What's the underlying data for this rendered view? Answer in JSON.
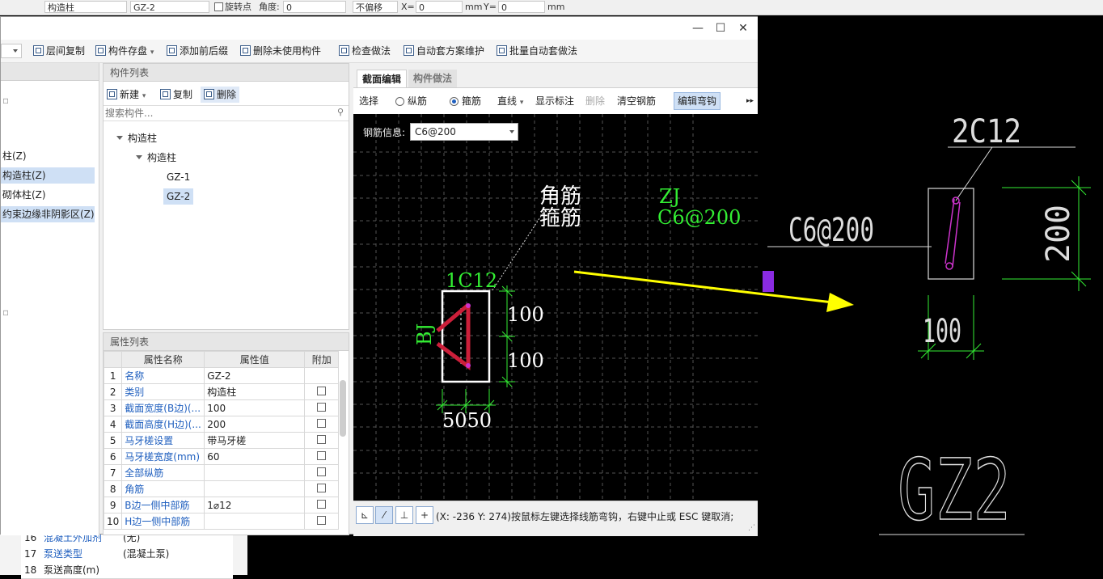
{
  "top_strip": {
    "type_value": "构造柱",
    "name_value": "GZ-2",
    "rotate_label": "旋转点",
    "angle_label": "角度:",
    "angle_value": "0",
    "offset_value": "不偏移",
    "x_label": "X=",
    "x_value": "0",
    "mm1": "mm",
    "y_label": "Y=",
    "y_value": "0",
    "mm2": "mm"
  },
  "toolbar": {
    "floor_copy": "层间复制",
    "save_component": "构件存盘",
    "add_prefix": "添加前后缀",
    "delete_unused": "删除未使用构件",
    "check_method": "检查做法",
    "auto_scheme": "自动套方案维护",
    "batch_auto": "批量自动套做法"
  },
  "left_panel": {
    "items": [
      "柱(Z)",
      "构造柱(Z)",
      "砌体柱(Z)",
      "约束边缘非阴影区(Z)"
    ]
  },
  "component_list": {
    "header": "构件列表",
    "new_label": "新建",
    "copy_label": "复制",
    "delete_label": "删除",
    "search_placeholder": "搜索构件...",
    "tree": {
      "root": "构造柱",
      "group": "构造柱",
      "items": [
        "GZ-1",
        "GZ-2"
      ]
    }
  },
  "property_list": {
    "header": "属性列表",
    "col_name": "属性名称",
    "col_value": "属性值",
    "col_extra": "附加",
    "rows": [
      {
        "no": "1",
        "name": "名称",
        "value": "GZ-2",
        "check": false
      },
      {
        "no": "2",
        "name": "类别",
        "value": "构造柱",
        "check": true
      },
      {
        "no": "3",
        "name": "截面宽度(B边)(...",
        "value": "100",
        "check": true
      },
      {
        "no": "4",
        "name": "截面高度(H边)(...",
        "value": "200",
        "check": true
      },
      {
        "no": "5",
        "name": "马牙槎设置",
        "value": "带马牙槎",
        "check": true
      },
      {
        "no": "6",
        "name": "马牙槎宽度(mm)",
        "value": "60",
        "check": true
      },
      {
        "no": "7",
        "name": "全部纵筋",
        "value": "",
        "check": true
      },
      {
        "no": "8",
        "name": "角筋",
        "value": "",
        "check": true
      },
      {
        "no": "9",
        "name": "B边一侧中部筋",
        "value": "1⌀12",
        "check": true
      },
      {
        "no": "10",
        "name": "H边一侧中部筋",
        "value": "",
        "check": true
      }
    ]
  },
  "background_rows": [
    {
      "no": "16",
      "name": "混凝土外加剂",
      "value": "(无)"
    },
    {
      "no": "17",
      "name": "泵送类型",
      "value": "(混凝土泵)"
    },
    {
      "no": "18",
      "name": "泵送高度(m)",
      "value": ""
    }
  ],
  "editor": {
    "tab_section": "截面编辑",
    "tab_method": "构件做法",
    "select": "选择",
    "longitudinal": "纵筋",
    "stirrup": "箍筋",
    "line": "直线",
    "show_label": "显示标注",
    "delete": "删除",
    "clear_rebar": "清空钢筋",
    "edit_hook": "编辑弯钩",
    "rebar_info_label": "钢筋信息:",
    "rebar_info_value": "C6@200",
    "drawing": {
      "corner_label": "角筋",
      "stirrup_label": "箍筋",
      "zj_label": "ZJ",
      "zj_value": "C6@200",
      "rebar_top": "1C12",
      "bj_label": "BJ",
      "dim_right_1": "100",
      "dim_right_2": "100",
      "dim_bottom": "5050"
    },
    "status_text": "(X: -236 Y: 274)按鼠标左键选择线筋弯钩，右键中止或 ESC 键取消;"
  },
  "cad": {
    "rebar_label": "2C12",
    "stirrup_label": "C6@200",
    "dim_height": "200",
    "dim_width": "100",
    "name": "GZ2"
  },
  "colors": {
    "cad_green": "#33ee33",
    "arrow_yellow": "#ffff00",
    "rebar_red": "#cc1f3a",
    "magenta": "#cc33cc"
  }
}
